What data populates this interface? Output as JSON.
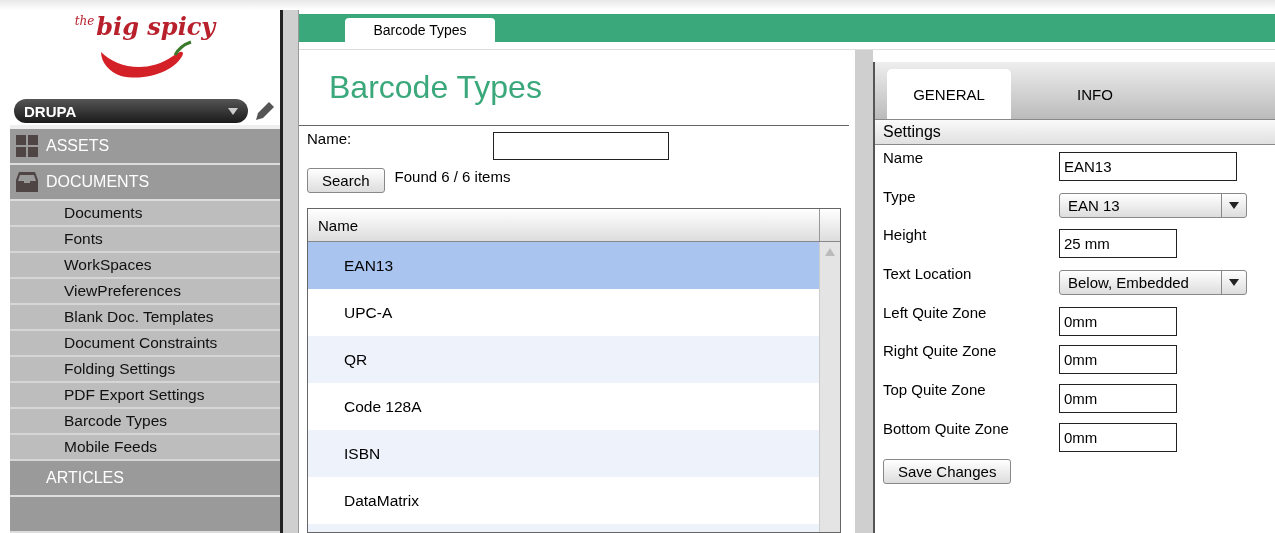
{
  "logo": {
    "prefix": "the",
    "name": "big spicy"
  },
  "workspace": {
    "value": "DRUPA"
  },
  "nav": [
    {
      "label": "ASSETS",
      "kind": "grid"
    },
    {
      "label": "DOCUMENTS",
      "kind": "tray",
      "children": [
        "Documents",
        "Fonts",
        "WorkSpaces",
        "ViewPreferences",
        "Blank Doc. Templates",
        "Document Constraints",
        "Folding Settings",
        "PDF Export Settings",
        "Barcode Types",
        "Mobile Feeds"
      ]
    },
    {
      "label": "ARTICLES",
      "kind": "plain"
    }
  ],
  "tabs": [
    {
      "label": "Barcode Types",
      "selected": true
    }
  ],
  "page_title": "Barcode Types",
  "search": {
    "label": "Name:",
    "button": "Search",
    "result": "Found 6 / 6 items"
  },
  "table": {
    "columns": [
      "Name"
    ],
    "rows": [
      {
        "name": "EAN13",
        "selected": true
      },
      {
        "name": "UPC-A",
        "selected": false
      },
      {
        "name": "QR",
        "selected": false
      },
      {
        "name": "Code 128A",
        "selected": false
      },
      {
        "name": "ISBN",
        "selected": false
      },
      {
        "name": "DataMatrix",
        "selected": false
      }
    ]
  },
  "detail": {
    "tabs": [
      {
        "label": "GENERAL",
        "selected": true
      },
      {
        "label": "INFO",
        "selected": false
      }
    ],
    "section": "Settings",
    "fields": [
      {
        "label": "Name",
        "kind": "wide",
        "value": "EAN13"
      },
      {
        "label": "Type",
        "kind": "select",
        "value": "EAN 13"
      },
      {
        "label": "Height",
        "kind": "text",
        "value": "25 mm"
      },
      {
        "label": "Text Location",
        "kind": "select",
        "value": "Below, Embedded"
      },
      {
        "label": "Left Quite Zone",
        "kind": "text",
        "value": "0mm"
      },
      {
        "label": "Right Quite Zone",
        "kind": "text",
        "value": "0mm"
      },
      {
        "label": "Top Quite Zone",
        "kind": "text",
        "value": "0mm"
      },
      {
        "label": "Bottom Quite Zone",
        "kind": "text",
        "value": "0mm"
      }
    ],
    "save_button": "Save Changes"
  }
}
